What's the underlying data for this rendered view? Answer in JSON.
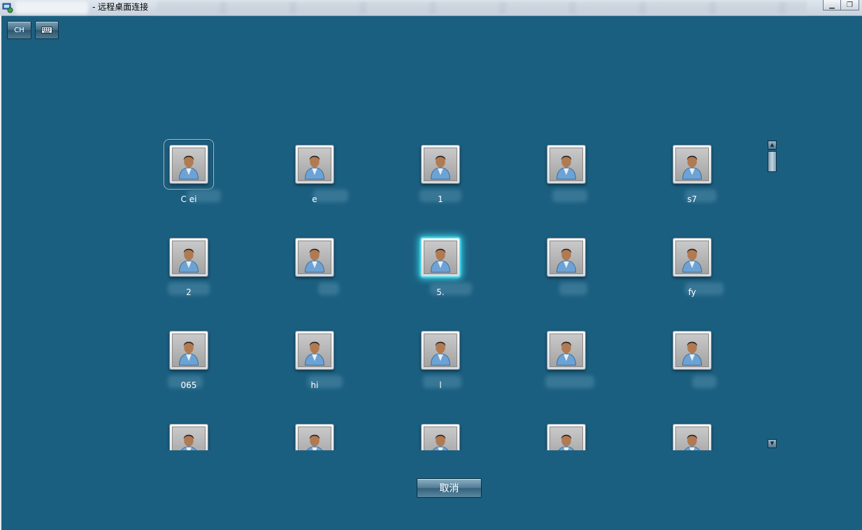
{
  "window": {
    "title": "- 远程桌面连接",
    "minimize_label": "▁",
    "restore_label": "❐"
  },
  "toolbar": {
    "language_label": "CH",
    "keyboard_icon": "keyboard-icon"
  },
  "users": [
    {
      "label": "C      ei",
      "state": "focused"
    },
    {
      "label": "      e"
    },
    {
      "label": "1"
    },
    {
      "label": ""
    },
    {
      "label": "      s7"
    },
    {
      "label": "2"
    },
    {
      "label": ""
    },
    {
      "label": "5.",
      "state": "selected"
    },
    {
      "label": ""
    },
    {
      "label": "      fy"
    },
    {
      "label": "      065"
    },
    {
      "label": "      hi"
    },
    {
      "label": "      l"
    },
    {
      "label": ""
    },
    {
      "label": ""
    },
    {
      "label": ""
    },
    {
      "label": ""
    },
    {
      "label": ""
    },
    {
      "label": ""
    },
    {
      "label": ""
    }
  ],
  "scrollbar": {
    "up_icon": "▲",
    "down_icon": "▼"
  },
  "footer": {
    "cancel_label": "取消"
  },
  "colors": {
    "background": "#1b5f80",
    "selected_glow": "#37d6e8"
  }
}
